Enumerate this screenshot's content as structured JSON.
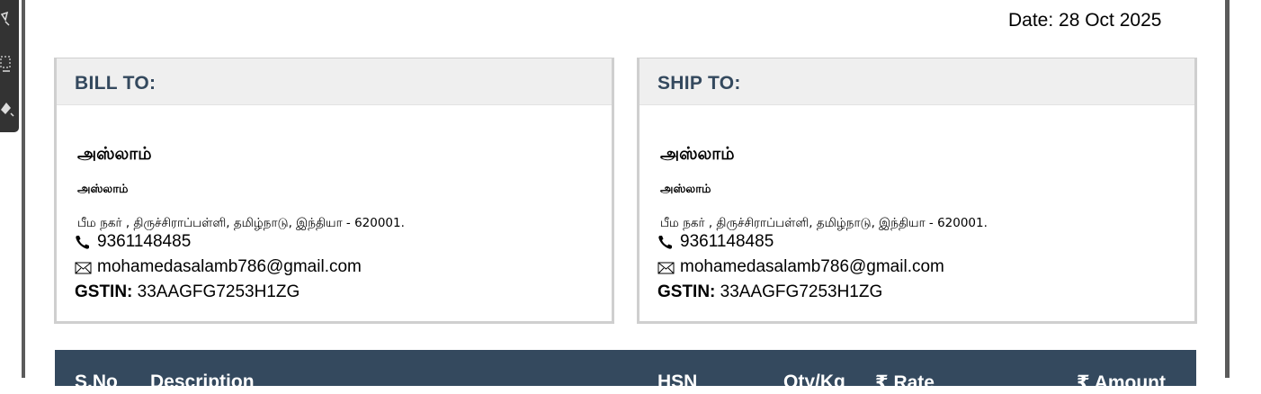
{
  "date": {
    "text": "Date: 28 Oct 2025"
  },
  "bill_to": {
    "heading": "BILL TO:",
    "name": "அஸ்லாம்",
    "subname": "அஸ்லாம்",
    "address": "பீம நகர் , திருச்சிராப்பள்ளி, தமிழ்நாடு, இந்தியா - 620001.",
    "phone": "9361148485",
    "email": "mohamedasalamb786@gmail.com",
    "gstin_label": "GSTIN:",
    "gstin_value": "33AAGFG7253H1ZG"
  },
  "ship_to": {
    "heading": "SHIP TO:",
    "name": "அஸ்லாம்",
    "subname": "அஸ்லாம்",
    "address": "பீம நகர் , திருச்சிராப்பள்ளி, தமிழ்நாடு, இந்தியா - 620001.",
    "phone": "9361148485",
    "email": "mohamedasalamb786@gmail.com",
    "gstin_label": "GSTIN:",
    "gstin_value": "33AAGFG7253H1ZG"
  },
  "table": {
    "headers": [
      "S.No",
      "Description",
      "HSN",
      "Qty/Kg",
      "₹ Rate",
      "₹ Amount"
    ]
  },
  "icons": {
    "phone": "phone-icon",
    "email": "envelope-icon",
    "tools": [
      "edit-icon",
      "select-icon",
      "paint-icon"
    ]
  },
  "colors": {
    "heading": "#34495e",
    "table_header_bg": "#34495e",
    "card_header_bg": "#efefef"
  }
}
